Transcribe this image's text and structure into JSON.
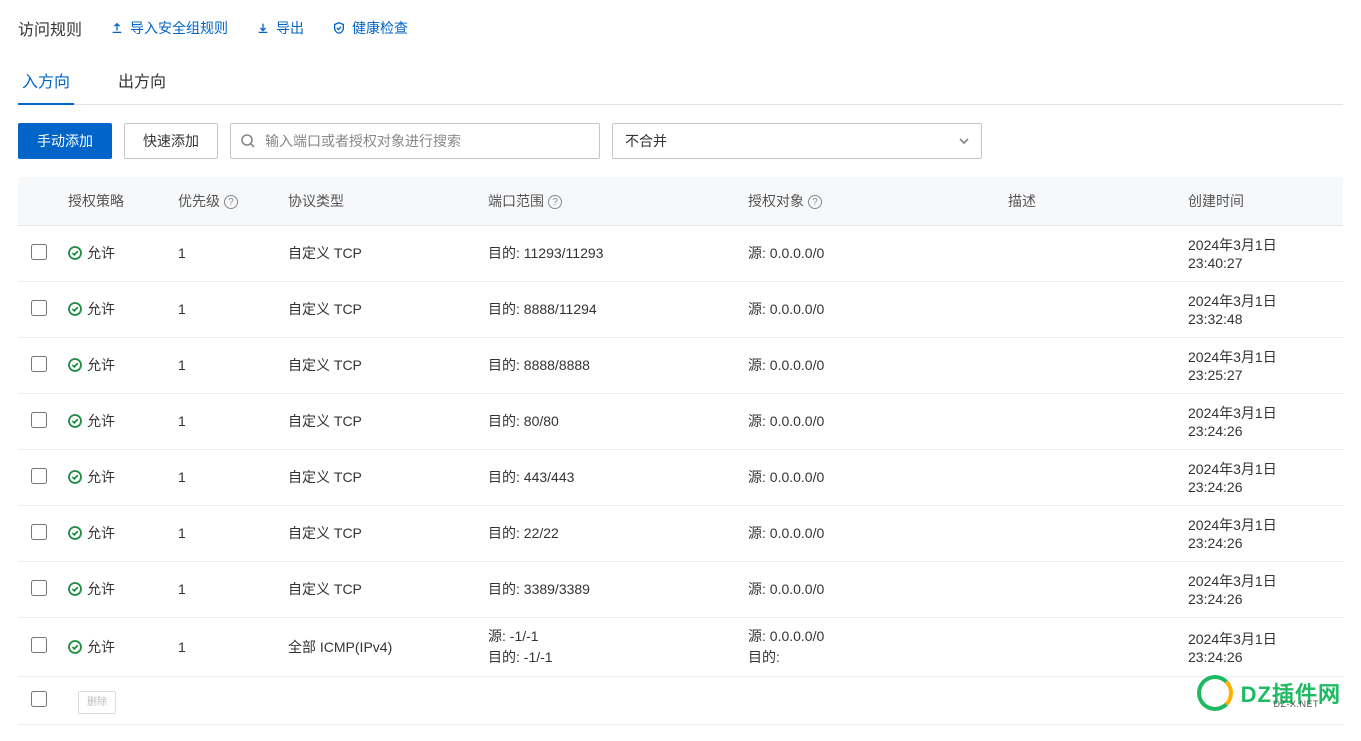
{
  "header": {
    "title": "访问规则",
    "links": {
      "import": "导入安全组规则",
      "export": "导出",
      "health": "健康检查"
    }
  },
  "tabs": {
    "inbound": "入方向",
    "outbound": "出方向"
  },
  "toolbar": {
    "manual_add": "手动添加",
    "quick_add": "快速添加",
    "search_placeholder": "输入端口或者授权对象进行搜索",
    "merge_option": "不合并"
  },
  "columns": {
    "policy": "授权策略",
    "priority": "优先级",
    "protocol": "协议类型",
    "port": "端口范围",
    "target": "授权对象",
    "desc": "描述",
    "created": "创建时间"
  },
  "rows": [
    {
      "policy": "允许",
      "priority": "1",
      "protocol": "自定义 TCP",
      "port": "目的: 11293/11293",
      "target": "源: 0.0.0.0/0",
      "desc": "",
      "created": "2024年3月1日 23:40:27"
    },
    {
      "policy": "允许",
      "priority": "1",
      "protocol": "自定义 TCP",
      "port": "目的: 8888/11294",
      "target": "源: 0.0.0.0/0",
      "desc": "",
      "created": "2024年3月1日 23:32:48"
    },
    {
      "policy": "允许",
      "priority": "1",
      "protocol": "自定义 TCP",
      "port": "目的: 8888/8888",
      "target": "源: 0.0.0.0/0",
      "desc": "",
      "created": "2024年3月1日 23:25:27"
    },
    {
      "policy": "允许",
      "priority": "1",
      "protocol": "自定义 TCP",
      "port": "目的: 80/80",
      "target": "源: 0.0.0.0/0",
      "desc": "",
      "created": "2024年3月1日 23:24:26"
    },
    {
      "policy": "允许",
      "priority": "1",
      "protocol": "自定义 TCP",
      "port": "目的: 443/443",
      "target": "源: 0.0.0.0/0",
      "desc": "",
      "created": "2024年3月1日 23:24:26"
    },
    {
      "policy": "允许",
      "priority": "1",
      "protocol": "自定义 TCP",
      "port": "目的: 22/22",
      "target": "源: 0.0.0.0/0",
      "desc": "",
      "created": "2024年3月1日 23:24:26"
    },
    {
      "policy": "允许",
      "priority": "1",
      "protocol": "自定义 TCP",
      "port": "目的: 3389/3389",
      "target": "源: 0.0.0.0/0",
      "desc": "",
      "created": "2024年3月1日 23:24:26"
    },
    {
      "policy": "允许",
      "priority": "1",
      "protocol": "全部 ICMP(IPv4)",
      "port": "源: -1/-1\n目的: -1/-1",
      "target": "源: 0.0.0.0/0\n目的:",
      "desc": "",
      "created": "2024年3月1日 23:24:26"
    }
  ],
  "footer": {
    "delete": "删除"
  },
  "watermark": {
    "brand": "DZ插件网",
    "sub": "DZ-X.NET"
  }
}
